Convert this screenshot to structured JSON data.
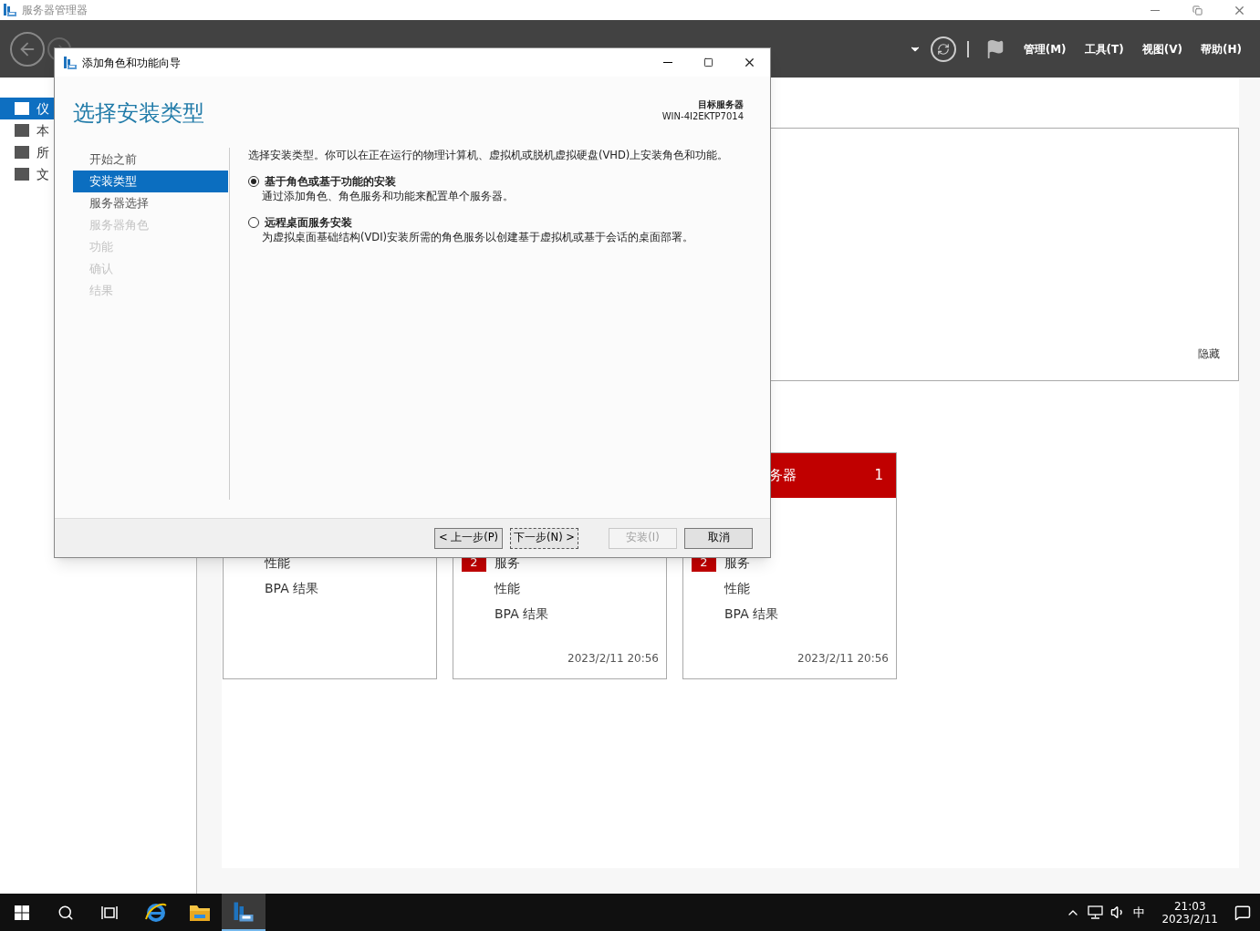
{
  "window": {
    "title": "服务器管理器"
  },
  "header": {
    "menus": [
      "管理(M)",
      "工具(T)",
      "视图(V)",
      "帮助(H)"
    ]
  },
  "sidebar": {
    "items": [
      {
        "label": "仪",
        "selected": true
      },
      {
        "label": "本",
        "selected": false
      },
      {
        "label": "所",
        "selected": false
      },
      {
        "label": "文",
        "selected": false
      }
    ]
  },
  "panel": {
    "link": "隐藏"
  },
  "tiles": [
    {
      "rows": [
        {
          "label": "性能"
        },
        {
          "label": "BPA 结果"
        }
      ]
    },
    {
      "rows": [
        {
          "badge": "2",
          "label": "服务"
        },
        {
          "label": "性能"
        },
        {
          "label": "BPA 结果"
        }
      ],
      "timestamp": "2023/2/11 20:56"
    },
    {
      "title": "务器",
      "count": "1",
      "rows": [
        {
          "badge": "2",
          "label": "服务"
        },
        {
          "label": "性能"
        },
        {
          "label": "BPA 结果"
        }
      ],
      "timestamp": "2023/2/11 20:56"
    }
  ],
  "dialog": {
    "title": "添加角色和功能向导",
    "heading": "选择安装类型",
    "target_label": "目标服务器",
    "target": "WIN-4I2EKTP7014",
    "steps": [
      {
        "label": "开始之前",
        "selected": false,
        "disabled": false
      },
      {
        "label": "安装类型",
        "selected": true,
        "disabled": false
      },
      {
        "label": "服务器选择",
        "selected": false,
        "disabled": false
      },
      {
        "label": "服务器角色",
        "selected": false,
        "disabled": true
      },
      {
        "label": "功能",
        "selected": false,
        "disabled": true
      },
      {
        "label": "确认",
        "selected": false,
        "disabled": true
      },
      {
        "label": "结果",
        "selected": false,
        "disabled": true
      }
    ],
    "intro": "选择安装类型。你可以在正在运行的物理计算机、虚拟机或脱机虚拟硬盘(VHD)上安装角色和功能。",
    "options": [
      {
        "label": "基于角色或基于功能的安装",
        "description": "通过添加角色、角色服务和功能来配置单个服务器。",
        "selected": true
      },
      {
        "label": "远程桌面服务安装",
        "description": "为虚拟桌面基础结构(VDI)安装所需的角色服务以创建基于虚拟机或基于会话的桌面部署。",
        "selected": false
      }
    ],
    "buttons": [
      {
        "label": "< 上一步(P)",
        "disabled": false,
        "focused": false
      },
      {
        "label": "下一步(N) >",
        "disabled": false,
        "focused": true
      },
      {
        "label": "安装(I)",
        "disabled": true,
        "focused": false
      },
      {
        "label": "取消",
        "disabled": false,
        "focused": false
      }
    ]
  },
  "taskbar": {
    "apps": [
      {
        "kind": "ie",
        "active": false
      },
      {
        "kind": "folder",
        "active": false
      },
      {
        "kind": "server",
        "active": true
      }
    ],
    "ime": "中",
    "time": "21:03",
    "date": "2023/2/11"
  }
}
